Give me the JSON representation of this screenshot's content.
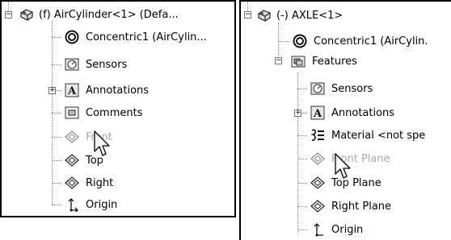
{
  "left_tree": {
    "root_label": "(f) AirCylinder<1> (Defa...",
    "items": [
      {
        "label": "Concentric1 (AirCylin...",
        "icon": "concentric-mate-icon"
      },
      {
        "label": "Sensors",
        "icon": "sensors-icon"
      },
      {
        "label": "Annotations",
        "icon": "annotations-icon"
      },
      {
        "label": "Comments",
        "icon": "comments-icon"
      },
      {
        "label": "Front",
        "icon": "plane-icon"
      },
      {
        "label": "Top",
        "icon": "plane-icon"
      },
      {
        "label": "Right",
        "icon": "plane-icon"
      },
      {
        "label": "Origin",
        "icon": "origin-icon"
      }
    ]
  },
  "right_tree": {
    "root_label": "(-) AXLE<1>",
    "items": [
      {
        "label": "Concentric1 (AirCylin.",
        "icon": "concentric-mate-icon"
      },
      {
        "label": "Features",
        "icon": "features-folder-icon"
      },
      {
        "label": "Sensors",
        "icon": "sensors-icon"
      },
      {
        "label": "Annotations",
        "icon": "annotations-icon"
      },
      {
        "label": "Material <not spe",
        "icon": "material-icon"
      },
      {
        "label": "Front Plane",
        "icon": "plane-icon"
      },
      {
        "label": "Top Plane",
        "icon": "plane-icon"
      },
      {
        "label": "Right Plane",
        "icon": "plane-icon"
      },
      {
        "label": "Origin",
        "icon": "origin-icon"
      }
    ]
  },
  "colors": {
    "disabled_text": "#a8a8a8",
    "tree_line": "#888888"
  }
}
